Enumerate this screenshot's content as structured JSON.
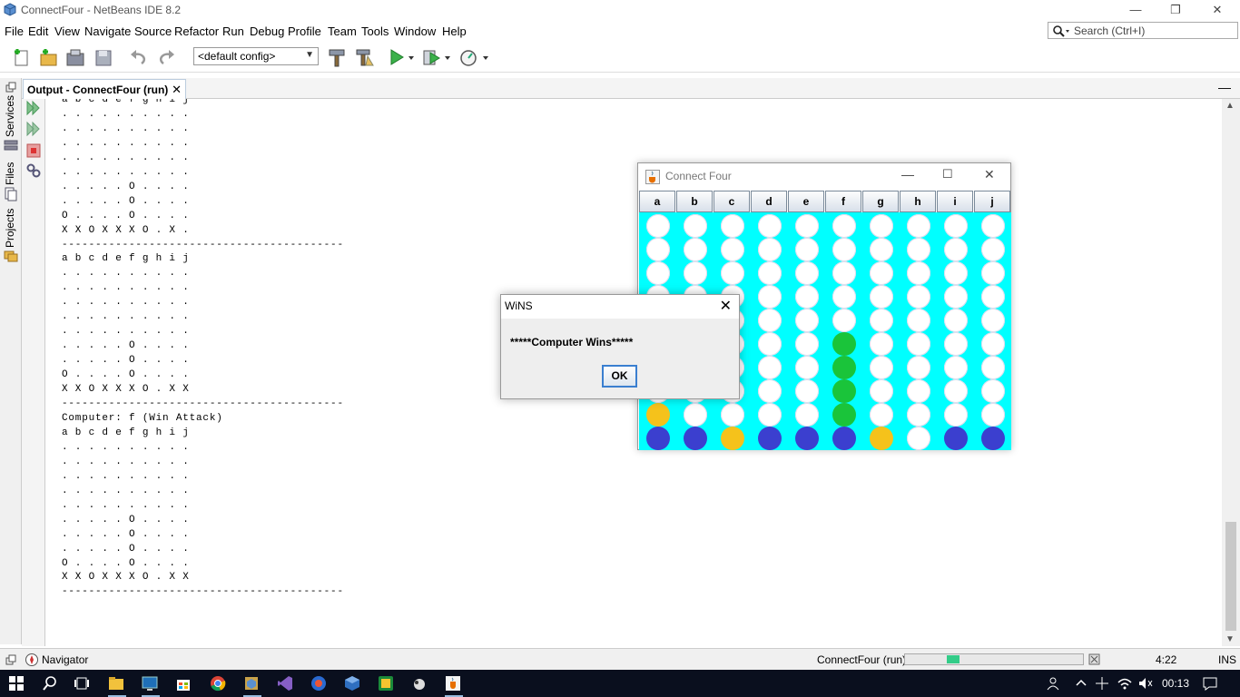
{
  "window": {
    "title": "ConnectFour - NetBeans IDE 8.2"
  },
  "menu": [
    "File",
    "Edit",
    "View",
    "Navigate",
    "Source",
    "Refactor",
    "Run",
    "Debug",
    "Profile",
    "Team",
    "Tools",
    "Window",
    "Help"
  ],
  "search": {
    "placeholder": "Search (Ctrl+I)"
  },
  "toolbar": {
    "config_value": "<default config>"
  },
  "side_tabs": [
    "Services",
    "Files",
    "Projects"
  ],
  "output": {
    "tab_label": "Output - ConnectFour (run)",
    "lines": [
      "a b c d e f g h i j",
      ". . . . . . . . . .",
      ". . . . . . . . . .",
      ". . . . . . . . . .",
      ". . . . . . . . . .",
      ". . . . . . . . . .",
      ". . . . . O . . . .",
      ". . . . . O . . . .",
      "O . . . . O . . . .",
      "X X O X X X O . X .",
      "------------------------------------------",
      "a b c d e f g h i j",
      ". . . . . . . . . .",
      ". . . . . . . . . .",
      ". . . . . . . . . .",
      ". . . . . . . . . .",
      ". . . . . . . . . .",
      ". . . . . O . . . .",
      ". . . . . O . . . .",
      "O . . . . O . . . .",
      "X X O X X X O . X X",
      "------------------------------------------",
      "Computer: f (Win Attack)",
      "a b c d e f g h i j",
      ". . . . . . . . . .",
      ". . . . . . . . . .",
      ". . . . . . . . . .",
      ". . . . . . . . . .",
      ". . . . . . . . . .",
      ". . . . . O . . . .",
      ". . . . . O . . . .",
      ". . . . . O . . . .",
      "O . . . . O . . . .",
      "X X O X X X O . X X",
      "------------------------------------------"
    ]
  },
  "status": {
    "navigator_label": "Navigator",
    "project_label": "ConnectFour (run)",
    "progress_fraction": 0.07,
    "position": "4:22",
    "mode": "INS"
  },
  "taskbar": {
    "time": "00:13"
  },
  "connect_four": {
    "title": "Connect Four",
    "columns": [
      "a",
      "b",
      "c",
      "d",
      "e",
      "f",
      "g",
      "h",
      "i",
      "j"
    ],
    "board": [
      "WWWWWWWWWW",
      "WWWWWWWWWW",
      "WWWWWWWWWW",
      "WWWWWWWWWW",
      "WWWWWWWWWW",
      "WWWWWGWWWW",
      "WWWWWGWWWW",
      "WWWWWGWWWW",
      "YWWWWGWWWW",
      "BBYBBBYWBB"
    ],
    "colors": {
      "W": "#ffffff",
      "B": "#3b3fcf",
      "Y": "#f5c21b",
      "G": "#1ac43a",
      "board": "#00ffff"
    }
  },
  "dialog": {
    "title": "WiNS",
    "message": "*****Computer Wins*****",
    "ok_label": "OK"
  }
}
